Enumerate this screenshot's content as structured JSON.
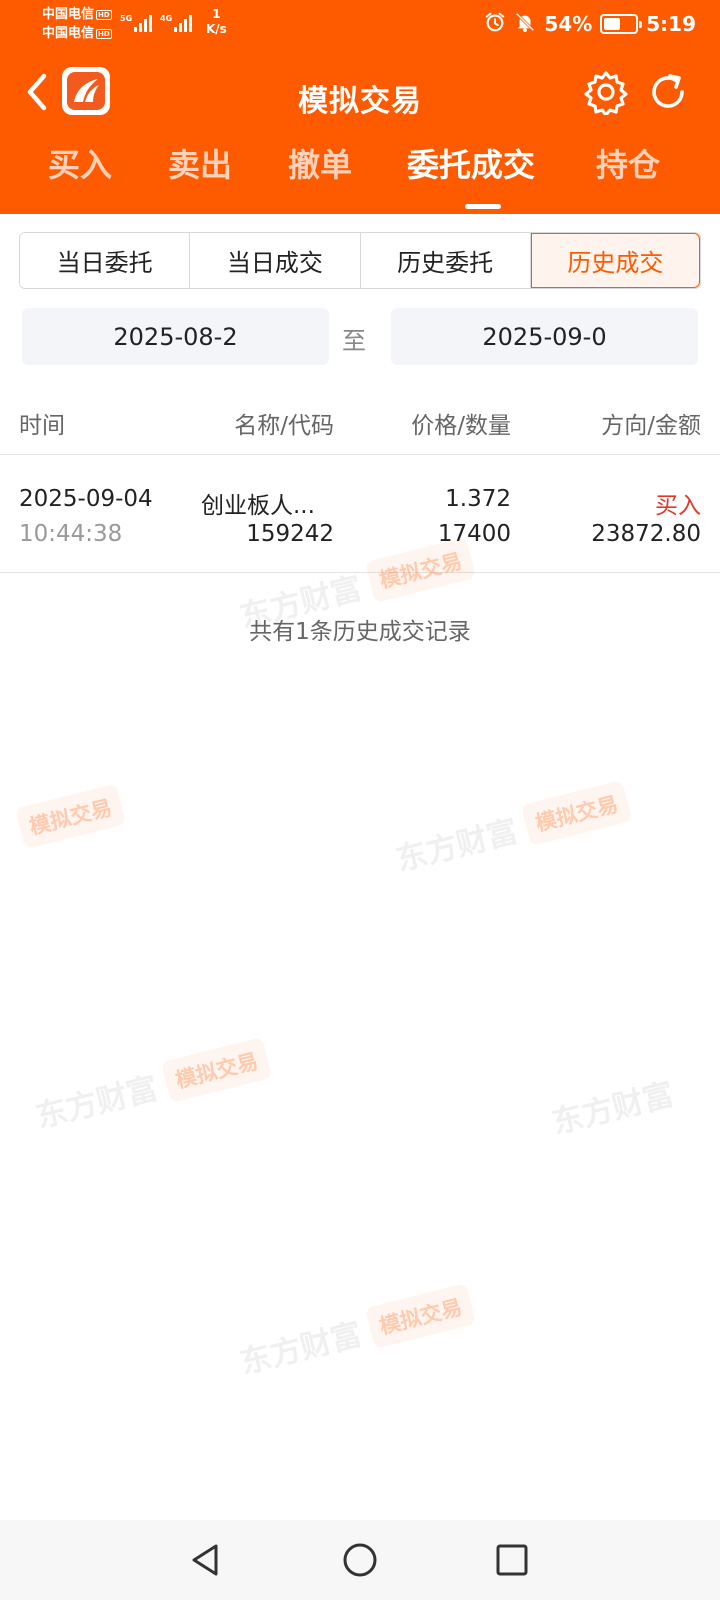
{
  "status_bar": {
    "carrier_1": "中国电信",
    "carrier_2": "中国电信",
    "hd": "HD",
    "network_1": "5G",
    "network_2": "4G",
    "speed_value": "1",
    "speed_unit": "K/s",
    "battery_percent": "54%",
    "time": "5:19"
  },
  "header": {
    "title": "模拟交易",
    "tabs": [
      {
        "label": "买入"
      },
      {
        "label": "卖出"
      },
      {
        "label": "撤单"
      },
      {
        "label": "委托成交"
      },
      {
        "label": "持仓"
      }
    ],
    "active_tab": "委托成交"
  },
  "segments": [
    {
      "label": "当日委托"
    },
    {
      "label": "当日成交"
    },
    {
      "label": "历史委托"
    },
    {
      "label": "历史成交"
    }
  ],
  "active_segment": "历史成交",
  "date_range": {
    "start": "2025-08-2",
    "separator": "至",
    "end": "2025-09-0"
  },
  "table": {
    "headers": {
      "time": "时间",
      "name_code": "名称/代码",
      "price_qty": "价格/数量",
      "dir_amount": "方向/金额"
    },
    "rows": [
      {
        "date": "2025-09-04",
        "time": "10:44:38",
        "name": "创业板人...",
        "code": "159242",
        "price": "1.372",
        "quantity": "17400",
        "direction": "买入",
        "amount": "23872.80"
      }
    ]
  },
  "summary": "共有1条历史成交记录",
  "watermark": {
    "brand": "东方财富",
    "tag": "模拟交易"
  },
  "colors": {
    "accent": "#fe5a00",
    "buy": "#e0392b"
  },
  "icons": {
    "back": "back-arrow-icon",
    "logo": "eastmoney-logo-icon",
    "settings": "gear-icon",
    "refresh": "refresh-icon",
    "nav_back": "triangle-back-icon",
    "nav_home": "circle-home-icon",
    "nav_recents": "square-recents-icon"
  }
}
